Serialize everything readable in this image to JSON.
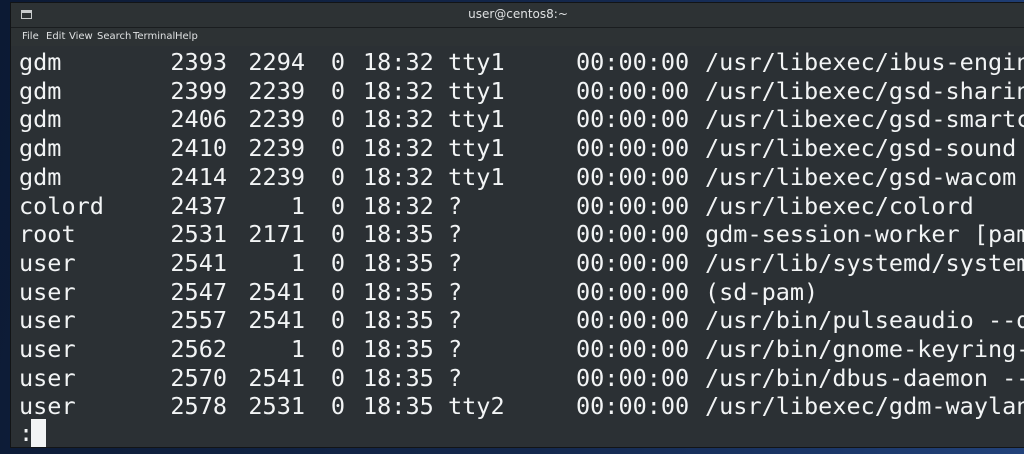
{
  "window": {
    "title": "user@centos8:~"
  },
  "menu": [
    "File",
    "Edit",
    "View",
    "Search",
    "Terminal",
    "Help"
  ],
  "rows": [
    {
      "user": "gdm",
      "pid": "2393",
      "ppid": "2294",
      "c": "0",
      "stime": "18:32",
      "tty": "tty1",
      "time": "00:00:00",
      "cmd": "/usr/libexec/ibus-engin"
    },
    {
      "user": "gdm",
      "pid": "2399",
      "ppid": "2239",
      "c": "0",
      "stime": "18:32",
      "tty": "tty1",
      "time": "00:00:00",
      "cmd": "/usr/libexec/gsd-sharin"
    },
    {
      "user": "gdm",
      "pid": "2406",
      "ppid": "2239",
      "c": "0",
      "stime": "18:32",
      "tty": "tty1",
      "time": "00:00:00",
      "cmd": "/usr/libexec/gsd-smartc"
    },
    {
      "user": "gdm",
      "pid": "2410",
      "ppid": "2239",
      "c": "0",
      "stime": "18:32",
      "tty": "tty1",
      "time": "00:00:00",
      "cmd": "/usr/libexec/gsd-sound"
    },
    {
      "user": "gdm",
      "pid": "2414",
      "ppid": "2239",
      "c": "0",
      "stime": "18:32",
      "tty": "tty1",
      "time": "00:00:00",
      "cmd": "/usr/libexec/gsd-wacom"
    },
    {
      "user": "colord",
      "pid": "2437",
      "ppid": "1",
      "c": "0",
      "stime": "18:32",
      "tty": "?",
      "time": "00:00:00",
      "cmd": "/usr/libexec/colord"
    },
    {
      "user": "root",
      "pid": "2531",
      "ppid": "2171",
      "c": "0",
      "stime": "18:35",
      "tty": "?",
      "time": "00:00:00",
      "cmd": "gdm-session-worker [pam"
    },
    {
      "user": "user",
      "pid": "2541",
      "ppid": "1",
      "c": "0",
      "stime": "18:35",
      "tty": "?",
      "time": "00:00:00",
      "cmd": "/usr/lib/systemd/system"
    },
    {
      "user": "user",
      "pid": "2547",
      "ppid": "2541",
      "c": "0",
      "stime": "18:35",
      "tty": "?",
      "time": "00:00:00",
      "cmd": "(sd-pam)"
    },
    {
      "user": "user",
      "pid": "2557",
      "ppid": "2541",
      "c": "0",
      "stime": "18:35",
      "tty": "?",
      "time": "00:00:00",
      "cmd": "/usr/bin/pulseaudio --d"
    },
    {
      "user": "user",
      "pid": "2562",
      "ppid": "1",
      "c": "0",
      "stime": "18:35",
      "tty": "?",
      "time": "00:00:00",
      "cmd": "/usr/bin/gnome-keyring-"
    },
    {
      "user": "user",
      "pid": "2570",
      "ppid": "2541",
      "c": "0",
      "stime": "18:35",
      "tty": "?",
      "time": "00:00:00",
      "cmd": "/usr/bin/dbus-daemon --"
    },
    {
      "user": "user",
      "pid": "2578",
      "ppid": "2531",
      "c": "0",
      "stime": "18:35",
      "tty": "tty2",
      "time": "00:00:00",
      "cmd": "/usr/libexec/gdm-waylan"
    }
  ],
  "prompt": {
    "text": ":"
  },
  "colors": {
    "terminal_bg": "#2b3034",
    "terminal_fg": "#f2f4f5",
    "titlebar_bg": "#2d3234"
  }
}
